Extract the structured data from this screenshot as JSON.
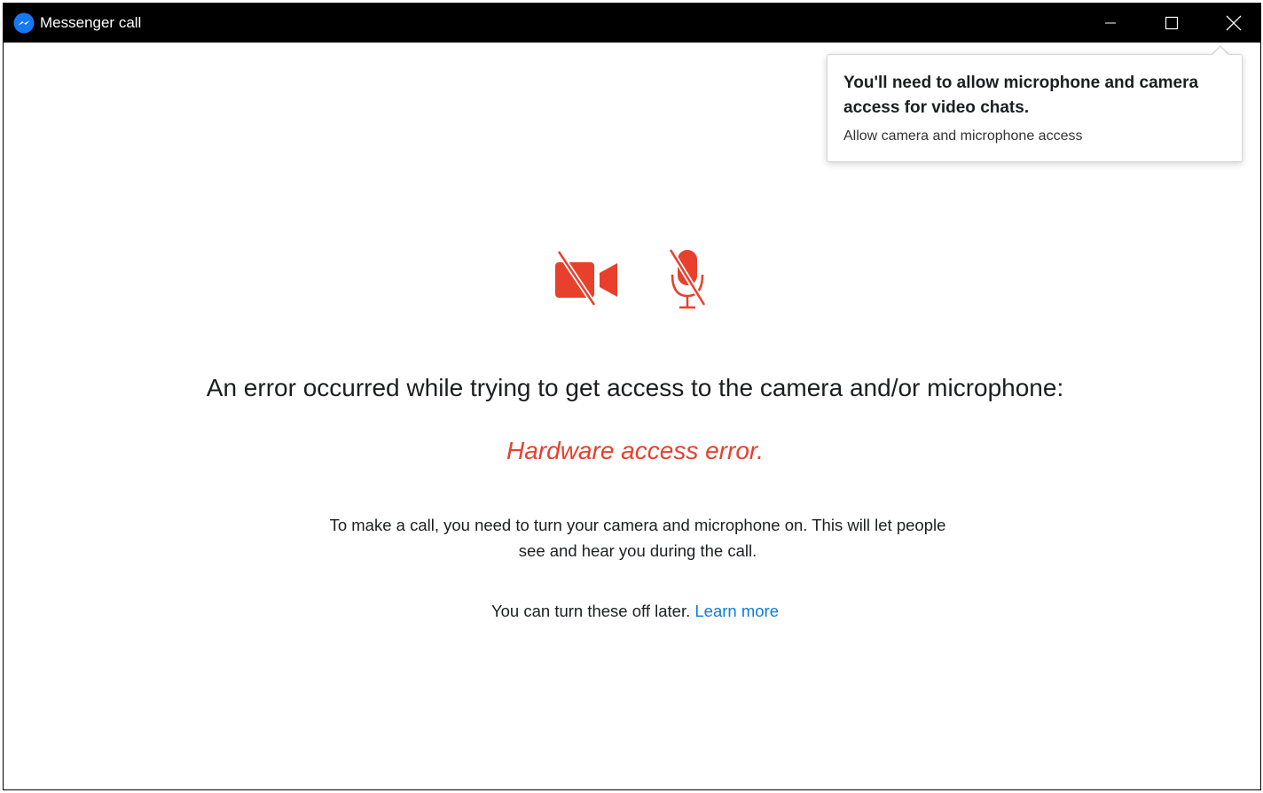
{
  "window": {
    "title": "Messenger call",
    "app_icon": "messenger-icon",
    "controls": [
      "minimize-icon",
      "maximize-icon",
      "close-icon"
    ]
  },
  "permission_popup": {
    "title": "You'll need to allow microphone and camera access for video chats.",
    "subtitle": "Allow camera and microphone access"
  },
  "status_icons": [
    "camera-off-icon",
    "microphone-off-icon"
  ],
  "main": {
    "heading": "An error occurred while trying to get access to the camera and/or microphone:",
    "error": "Hardware access error.",
    "explanation_line1": "To make a call, you need to turn your camera and microphone on. This will let people",
    "explanation_line2": "see and hear you during the call.",
    "later_text": "You can turn these off later.",
    "learn_more": "Learn more"
  },
  "colors": {
    "titlebar": "#000000",
    "error_red": "#e8402c",
    "link_blue": "#0a7cdd",
    "messenger_blue": "#1877f2"
  }
}
